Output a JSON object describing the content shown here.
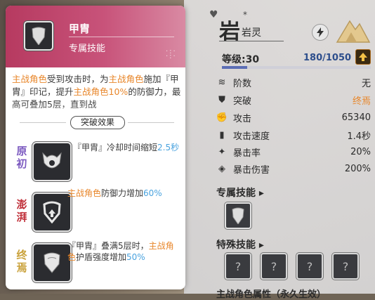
{
  "character": {
    "name_big": "岩",
    "name_small": "岩灵",
    "asterisk": "*",
    "level_label": "等级:30",
    "exp": "180/1050",
    "exp_fill": 0.17
  },
  "stats": [
    {
      "icon": "layers-icon",
      "label": "阶数",
      "value": "无"
    },
    {
      "icon": "shield-icon",
      "label": "突破",
      "value": "终焉"
    },
    {
      "icon": "fist-icon",
      "label": "攻击",
      "value": "65340"
    },
    {
      "icon": "bar-chart-icon",
      "label": "攻击速度",
      "value": "1.4秒"
    },
    {
      "icon": "crit-icon",
      "label": "暴击率",
      "value": "20%"
    },
    {
      "icon": "crit-damage-icon",
      "label": "暴击伤害",
      "value": "200%"
    }
  ],
  "sections": {
    "exclusive_skill": "专属技能 ▸",
    "special_skill": "特殊技能 ▸",
    "bottom_partial": "主战角色属性（永久生效）",
    "question": "?"
  },
  "popup": {
    "title": "甲胄",
    "subtitle": "专属技能",
    "desc": {
      "p1": "主战角色",
      "p2": "受到攻击时，为",
      "p3": "主战角色",
      "p4": "施加『甲胄』印记，提升",
      "p5": "主战角色10%",
      "p6": "的防御力，最高可叠加5层，直到战"
    },
    "breakthrough_title": "突破效果",
    "breakthroughs": [
      {
        "label": "原初",
        "t1": "『甲胄』冷却时间缩短",
        "t2": "2.5秒"
      },
      {
        "label": "澎湃",
        "t1": "主战角色",
        "t2": "防御力增加",
        "t3": "60%"
      },
      {
        "label": "终焉",
        "t1": "『甲胄』叠满5层时，",
        "t2": "主战角",
        "t3": "色",
        "t4": "护盾强度增加",
        "t5": "50%"
      }
    ]
  }
}
